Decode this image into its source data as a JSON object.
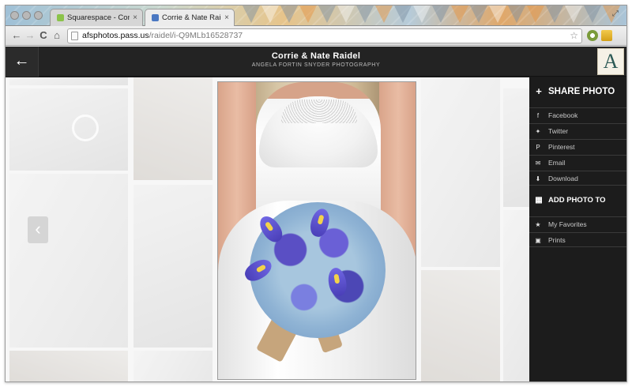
{
  "browser": {
    "tabs": [
      {
        "title": "Squarespace - Configurat",
        "active": false,
        "favicon_color": "#8bc34a"
      },
      {
        "title": "Corrie & Nate Raidel",
        "active": true,
        "favicon_color": "#4a78c2"
      }
    ],
    "close_glyph": "×",
    "url": {
      "host": "afsphotos.pass.us",
      "path": "/raidel/i-Q9MLb16528737"
    },
    "nav": {
      "back": "←",
      "forward": "→",
      "reload": "C",
      "home": "⌂",
      "star": "☆"
    }
  },
  "site": {
    "title": "Corrie & Nate Raidel",
    "subtitle": "ANGELA FORTIN SNYDER PHOTOGRAPHY",
    "back_glyph": "←",
    "logo_letter": "A",
    "prev_glyph": "‹"
  },
  "sidebar": {
    "share_heading": "SHARE PHOTO",
    "share_icon": "+",
    "share_items": [
      {
        "label": "Facebook",
        "icon": "f",
        "icon_name": "facebook-icon"
      },
      {
        "label": "Twitter",
        "icon": "✦",
        "icon_name": "twitter-icon"
      },
      {
        "label": "Pinterest",
        "icon": "P",
        "icon_name": "pinterest-icon"
      },
      {
        "label": "Email",
        "icon": "✉",
        "icon_name": "email-icon"
      },
      {
        "label": "Download",
        "icon": "⬇",
        "icon_name": "download-icon"
      }
    ],
    "add_heading": "ADD PHOTO TO",
    "add_icon": "▦",
    "add_items": [
      {
        "label": "My Favorites",
        "icon": "★",
        "icon_name": "star-icon"
      },
      {
        "label": "Prints",
        "icon": "▣",
        "icon_name": "prints-icon"
      }
    ]
  },
  "colors": {
    "header_bg": "#232323",
    "sidebar_bg": "#1c1c1c",
    "logo_teal": "#2d5a55"
  }
}
